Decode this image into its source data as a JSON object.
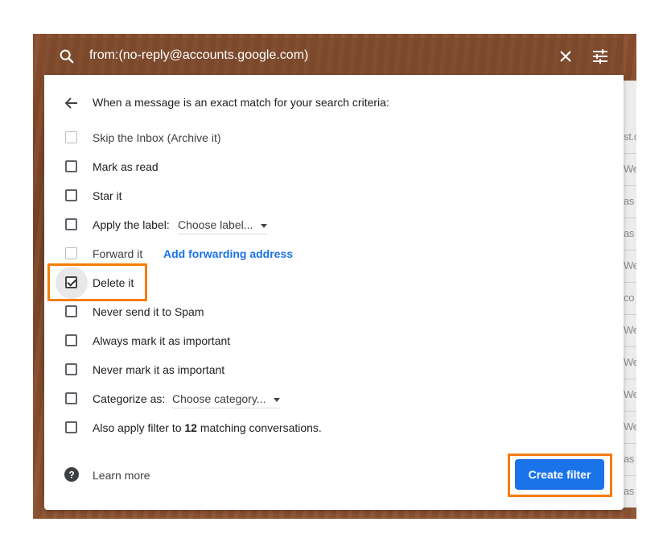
{
  "search": {
    "query": "from:(no-reply@accounts.google.com)"
  },
  "panel": {
    "header": "When a message is an exact match for your search criteria:"
  },
  "options": {
    "skip_inbox": "Skip the Inbox (Archive it)",
    "mark_read": "Mark as read",
    "star": "Star it",
    "apply_label": "Apply the label:",
    "label_select": "Choose label...",
    "forward": "Forward it",
    "forward_link": "Add forwarding address",
    "delete": "Delete it",
    "never_spam": "Never send it to Spam",
    "always_important": "Always mark it as important",
    "never_important": "Never mark it as important",
    "categorize": "Categorize as:",
    "category_select": "Choose category...",
    "also_apply_prefix": "Also apply filter to",
    "also_apply_count": "12",
    "also_apply_suffix": "matching conversations."
  },
  "footer": {
    "learn_more": "Learn more",
    "create_filter": "Create filter"
  },
  "background_snippets": [
    "st.c",
    "We",
    "as",
    "as",
    "We",
    "co",
    "We",
    "We",
    "We",
    "We",
    "as",
    "as"
  ],
  "colors": {
    "accent": "#1a73e8",
    "highlight": "#f57c00",
    "backdrop": "#7a4326"
  }
}
